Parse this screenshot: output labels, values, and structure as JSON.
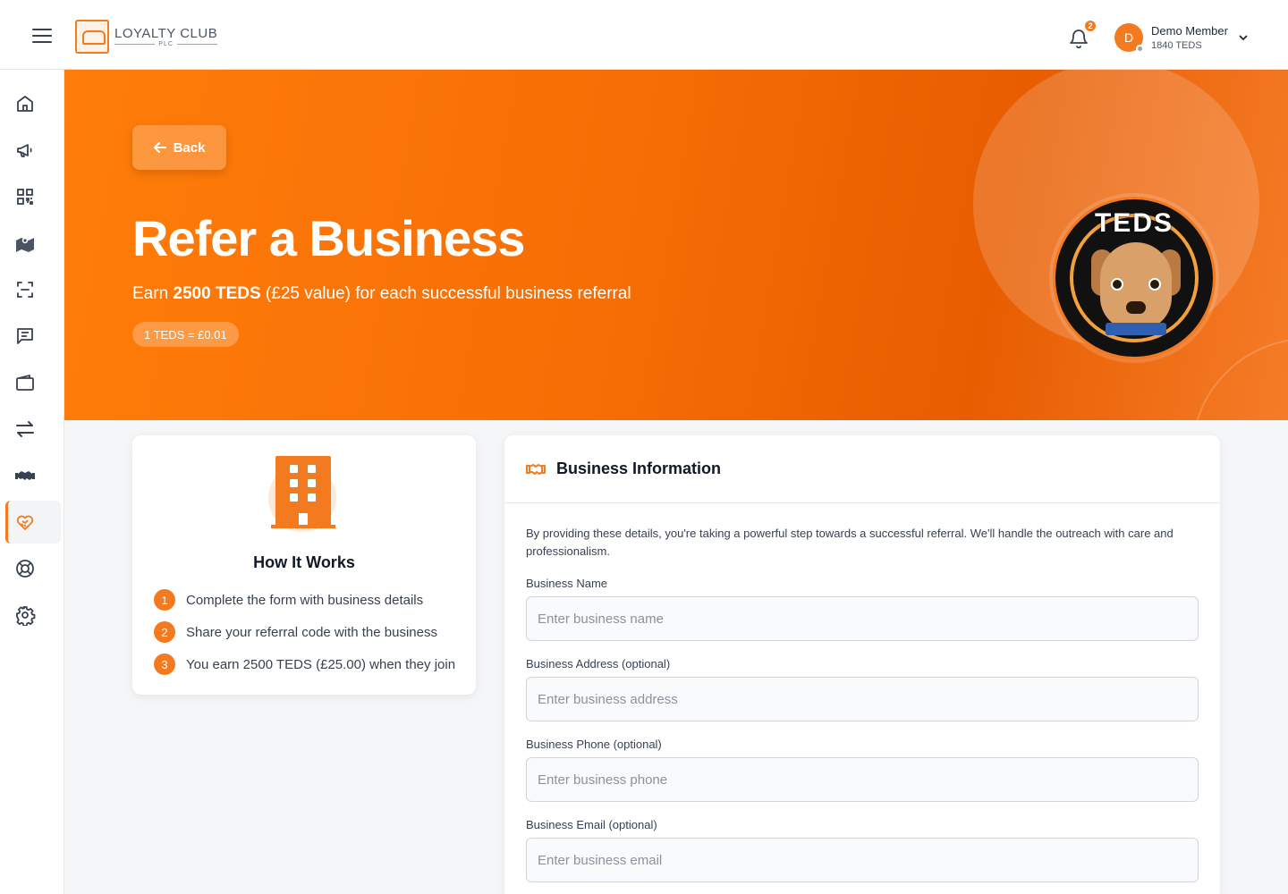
{
  "header": {
    "logo_title": "LOYALTY CLUB",
    "logo_sub": "PLC",
    "notification_count": "2",
    "user_initial": "D",
    "user_name": "Demo Member",
    "user_points": "1840 TEDS"
  },
  "sidebar": {
    "items": [
      {
        "icon": "home-icon",
        "active": false
      },
      {
        "icon": "megaphone-icon",
        "active": false
      },
      {
        "icon": "qr-code-icon",
        "active": false
      },
      {
        "icon": "map-icon",
        "active": false
      },
      {
        "icon": "scan-icon",
        "active": false
      },
      {
        "icon": "chat-icon",
        "active": false
      },
      {
        "icon": "wallet-icon",
        "active": false
      },
      {
        "icon": "transfer-icon",
        "active": false
      },
      {
        "icon": "handshake-icon",
        "active": false
      },
      {
        "icon": "heart-handshake-icon",
        "active": true
      },
      {
        "icon": "lifebuoy-icon",
        "active": false
      },
      {
        "icon": "gear-icon",
        "active": false
      }
    ]
  },
  "hero": {
    "back_label": "Back",
    "title": "Refer a Business",
    "subtitle_prefix": "Earn ",
    "subtitle_bold": "2500 TEDS",
    "subtitle_suffix": " (£25 value) for each successful business referral",
    "rate": "1 TEDS = £0.01",
    "badge_word": "TEDS"
  },
  "how": {
    "title": "How It Works",
    "steps": [
      {
        "num": "1",
        "text": "Complete the form with business details"
      },
      {
        "num": "2",
        "text": "Share your referral code with the business"
      },
      {
        "num": "3",
        "text": "You earn 2500 TEDS (£25.00) when they join"
      }
    ]
  },
  "form": {
    "title": "Business Information",
    "description": "By providing these details, you're taking a powerful step towards a successful referral. We'll handle the outreach with care and professionalism.",
    "fields": [
      {
        "label": "Business Name",
        "placeholder": "Enter business name",
        "value": ""
      },
      {
        "label": "Business Address (optional)",
        "placeholder": "Enter business address",
        "value": ""
      },
      {
        "label": "Business Phone (optional)",
        "placeholder": "Enter business phone",
        "value": ""
      },
      {
        "label": "Business Email (optional)",
        "placeholder": "Enter business email",
        "value": ""
      }
    ]
  },
  "colors": {
    "accent": "#f47a1f",
    "hero_start": "#ff7d0a",
    "hero_end": "#e85d00"
  }
}
